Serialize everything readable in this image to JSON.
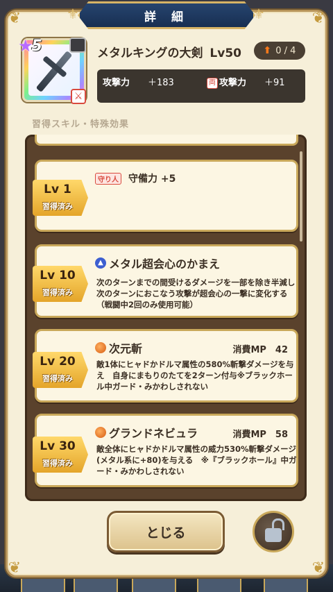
{
  "header": {
    "title": "詳 細"
  },
  "weapon": {
    "stars": "5",
    "name": "メタルキングの大剣",
    "level": "Lv50",
    "upgrade": "0 / 4",
    "stats": [
      {
        "label": "攻撃力",
        "value": "＋183"
      },
      {
        "label": "攻撃力",
        "value": "＋91",
        "tag": "両"
      }
    ]
  },
  "section_title": "習得スキル・特殊効果",
  "skills": [
    {
      "lv": "Lv 1",
      "status": "習得済み",
      "tag": "守り人",
      "title": "守備力 +5",
      "mp": "",
      "desc": ""
    },
    {
      "lv": "Lv 10",
      "status": "習得済み",
      "icon": "blue-skill-icon",
      "title": "メタル超会心のかまえ",
      "mp": "",
      "desc": "次のターンまでの間受けるダメージを一部を除き半減し　次のターンにおこなう攻撃が超会心の一撃に変化する（戦闘中2回のみ使用可能）"
    },
    {
      "lv": "Lv 20",
      "status": "習得済み",
      "icon": "orange-skill-icon",
      "title": "次元斬",
      "mp": "消費MP　42",
      "desc": "敵1体にヒャドかドルマ属性の580%斬撃ダメージを与え　自身にまもりのたてを2ターン付与※ブラックホール中ガード・みかわしされない"
    },
    {
      "lv": "Lv 30",
      "status": "習得済み",
      "icon": "orange-skill-icon",
      "title": "グランドネビュラ",
      "mp": "消費MP　58",
      "desc": "敵全体にヒャドかドルマ属性の威力530%斬撃ダメージ(メタル系に+80)を与える　※『ブラックホール』中ガード・みかわしされない"
    }
  ],
  "buttons": {
    "close": "とじる"
  },
  "colors": {
    "panel": "#f6efd9",
    "gold": "#c9a85a",
    "frame": "#5a422c",
    "header": "#26446e"
  }
}
